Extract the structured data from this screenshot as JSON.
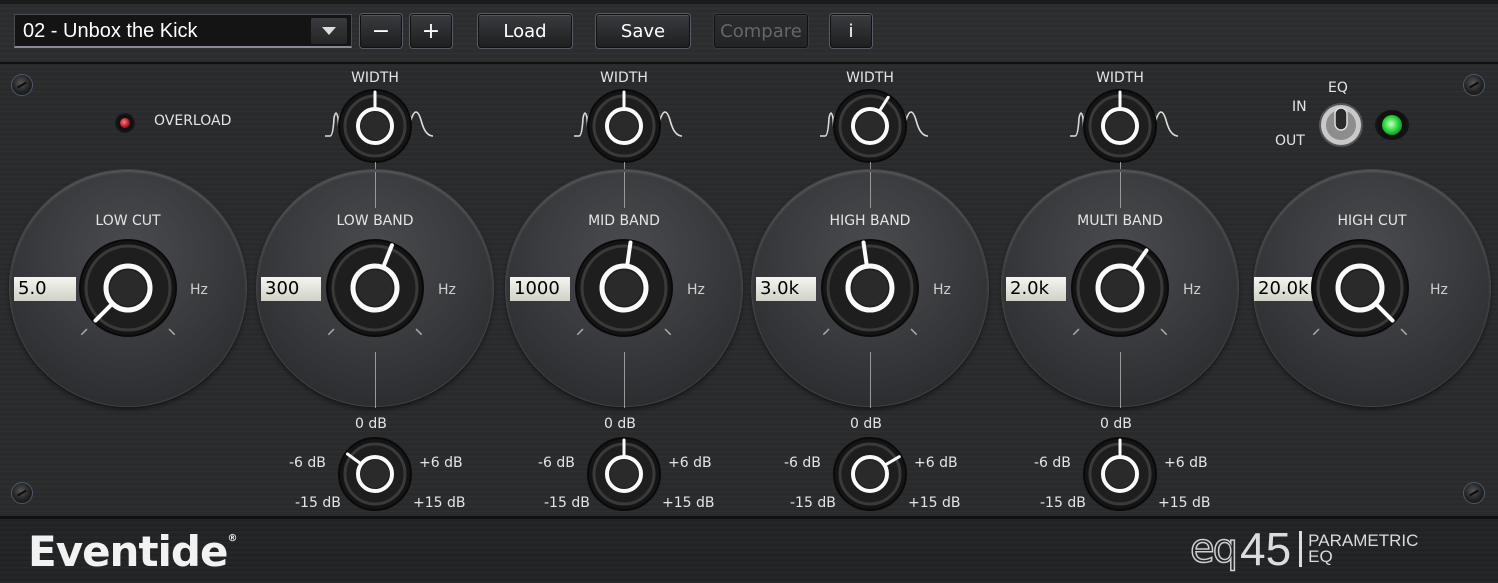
{
  "toolbar": {
    "preset_name": "02 - Unbox the Kick",
    "minus_label": "−",
    "plus_label": "+",
    "load_label": "Load",
    "save_label": "Save",
    "compare_label": "Compare",
    "info_label": "i"
  },
  "overload": {
    "label": "OVERLOAD",
    "led_color": "#b01e24"
  },
  "eq_switch": {
    "title": "EQ",
    "in_label": "IN",
    "out_label": "OUT",
    "state": "IN",
    "led_color": "#2bd83a"
  },
  "low_cut": {
    "label": "LOW CUT",
    "value": "5.0",
    "unit": "Hz",
    "knob_position": 0.0
  },
  "high_cut": {
    "label": "HIGH CUT",
    "value": "20.0k",
    "unit": "Hz",
    "knob_position": 1.0
  },
  "bands": [
    {
      "label": "LOW  BAND",
      "value": "300",
      "unit": "Hz",
      "freq_knob_position": 0.58,
      "width_label": "WIDTH",
      "width_knob_position": 0.5,
      "gain_knob_position": 0.3
    },
    {
      "label": "MID  BAND",
      "value": "1000",
      "unit": "Hz",
      "freq_knob_position": 0.53,
      "width_label": "WIDTH",
      "width_knob_position": 0.5,
      "gain_knob_position": 0.5
    },
    {
      "label": "HIGH BAND",
      "value": "3.0k",
      "unit": "Hz",
      "freq_knob_position": 0.47,
      "width_label": "WIDTH",
      "width_knob_position": 0.62,
      "gain_knob_position": 0.72
    },
    {
      "label": "MULTI BAND",
      "value": "2.0k",
      "unit": "Hz",
      "freq_knob_position": 0.63,
      "width_label": "WIDTH",
      "width_knob_position": 0.5,
      "gain_knob_position": 0.5
    }
  ],
  "gain_scale": {
    "zero": "0 dB",
    "minus6": "-6 dB",
    "plus6": "+6 dB",
    "minus15": "-15 dB",
    "plus15": "+15 dB"
  },
  "footer": {
    "brand": "Eventide",
    "registered": "®",
    "product_eq": "eq",
    "product_num": "45",
    "product_line1": "PARAMETRIC",
    "product_line2": "EQ"
  }
}
